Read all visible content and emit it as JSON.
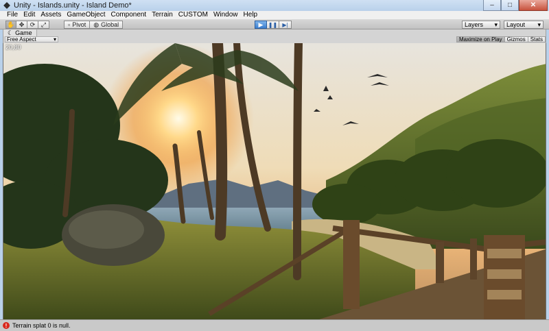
{
  "window": {
    "title": "Unity - Islands.unity - Island Demo*",
    "minimize_glyph": "–",
    "maximize_glyph": "□",
    "close_glyph": "✕"
  },
  "menu": {
    "items": [
      {
        "label": "File"
      },
      {
        "label": "Edit"
      },
      {
        "label": "Assets"
      },
      {
        "label": "GameObject"
      },
      {
        "label": "Component"
      },
      {
        "label": "Terrain"
      },
      {
        "label": "CUSTOM"
      },
      {
        "label": "Window"
      },
      {
        "label": "Help"
      }
    ]
  },
  "toolbar": {
    "tools": [
      {
        "name": "hand-tool",
        "icon": "hand-icon",
        "glyph": "✋",
        "active": true
      },
      {
        "name": "move-tool",
        "icon": "move-icon",
        "glyph": "✥",
        "active": false
      },
      {
        "name": "rotate-tool",
        "icon": "rotate-icon",
        "glyph": "⟳",
        "active": false
      },
      {
        "name": "scale-tool",
        "icon": "scale-icon",
        "glyph": "⤢",
        "active": false
      }
    ],
    "pivot_label": "Pivot",
    "global_label": "Global",
    "play": {
      "play_glyph": "▶",
      "pause_glyph": "❚❚",
      "step_glyph": "▶|",
      "playing": true
    },
    "layers_label": "Layers",
    "layout_label": "Layout",
    "dropdown_arrow": "▾"
  },
  "game_view": {
    "tab_label": "Game",
    "aspect_label": "Free Aspect",
    "maximize_on_play_label": "Maximize on Play",
    "maximize_on_play": true,
    "gizmos_label": "Gizmos",
    "stats_label": "Stats",
    "fps_readout": "20,80"
  },
  "status": {
    "icon": "error-icon",
    "icon_glyph": "!",
    "message": "Terrain splat 0 is null.",
    "color": "#d9271b"
  }
}
